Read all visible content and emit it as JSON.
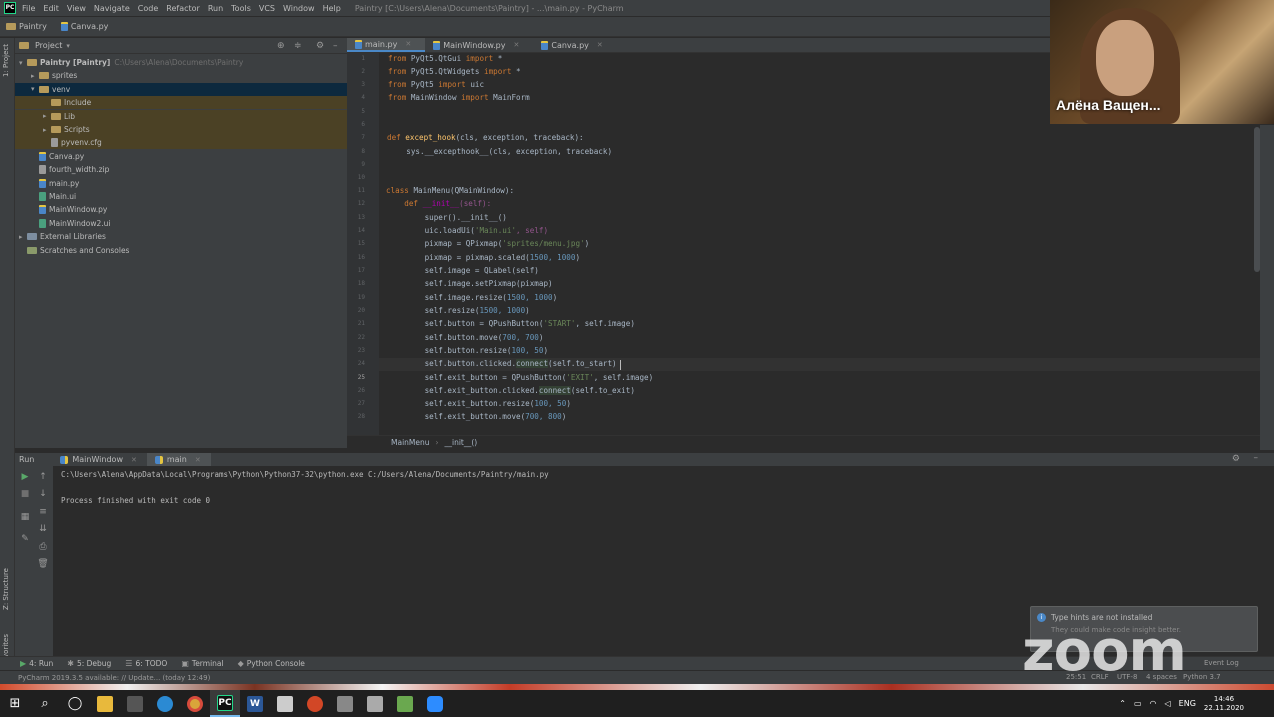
{
  "menubar": {
    "items": [
      "File",
      "Edit",
      "View",
      "Navigate",
      "Code",
      "Refactor",
      "Run",
      "Tools",
      "VCS",
      "Window",
      "Help"
    ],
    "window_title": "Paintry [C:\\Users\\Alena\\Documents\\Paintry] - ...\\main.py - PyCharm"
  },
  "navbar": {
    "project": "Paintry",
    "file": "Canva.py"
  },
  "left_stripe": {
    "project_tab": "1: Project",
    "structure_tab": "Z: Structure",
    "favorites_tab": "2: Favorites"
  },
  "project_panel": {
    "title": "Project",
    "tree": [
      {
        "label": "Paintry [Paintry]",
        "hint": "C:\\Users\\Alena\\Documents\\Paintry",
        "kind": "folder",
        "indent": 1,
        "arrow": "▾"
      },
      {
        "label": "sprites",
        "kind": "folder",
        "indent": 2,
        "arrow": "▸"
      },
      {
        "label": "venv",
        "kind": "folder",
        "indent": 2,
        "arrow": "▾",
        "state": "selected"
      },
      {
        "label": "Include",
        "kind": "folder",
        "indent": 3,
        "arrow": "",
        "state": "hl"
      },
      {
        "label": "Lib",
        "kind": "folder",
        "indent": 3,
        "arrow": "▸",
        "state": "hl"
      },
      {
        "label": "Scripts",
        "kind": "folder",
        "indent": 3,
        "arrow": "▸",
        "state": "hl"
      },
      {
        "label": "pyvenv.cfg",
        "kind": "txt",
        "indent": 3,
        "arrow": "",
        "state": "hl"
      },
      {
        "label": "Canva.py",
        "kind": "py",
        "indent": 2,
        "arrow": ""
      },
      {
        "label": "fourth_width.zip",
        "kind": "txt",
        "indent": 2,
        "arrow": ""
      },
      {
        "label": "main.py",
        "kind": "py",
        "indent": 2,
        "arrow": ""
      },
      {
        "label": "Main.ui",
        "kind": "ui",
        "indent": 2,
        "arrow": ""
      },
      {
        "label": "MainWindow.py",
        "kind": "py",
        "indent": 2,
        "arrow": ""
      },
      {
        "label": "MainWindow2.ui",
        "kind": "ui",
        "indent": 2,
        "arrow": ""
      },
      {
        "label": "External Libraries",
        "kind": "lib",
        "indent": 1,
        "arrow": "▸"
      },
      {
        "label": "Scratches and Consoles",
        "kind": "scratch",
        "indent": 1,
        "arrow": ""
      }
    ]
  },
  "editor_tabs": [
    {
      "label": "main.py",
      "active": true
    },
    {
      "label": "MainWindow.py",
      "active": false
    },
    {
      "label": "Canva.py",
      "active": false
    }
  ],
  "editor": {
    "line_numbers": [
      "1",
      "2",
      "3",
      "4",
      "5",
      "6",
      "7",
      "8",
      "9",
      "10",
      "11",
      "12",
      "13",
      "14",
      "15",
      "16",
      "17",
      "18",
      "19",
      "20",
      "21",
      "22",
      "23",
      "24",
      "25",
      "26",
      "27",
      "28"
    ],
    "code": {
      "l1": "from PyQt5.QtGui import *",
      "l2": "from PyQt5.QtWidgets import *",
      "l3": "from PyQt5 import uic",
      "l4": "from MainWindow import MainForm",
      "l8_def": "def ",
      "l8_fn": "except_hook",
      "l8_rest": "(cls, exception, traceback):",
      "l9": "    sys.__excepthook__(cls, exception, traceback)",
      "l12_kw": "class ",
      "l12_rest": "MainMenu(QMainWindow):",
      "l13_def": "    def ",
      "l13_fn": "__init__",
      "l13_self": "(self):",
      "l14": "        super().__init__()",
      "l15_a": "        uic.loadUi(",
      "l15_s": "'Main.ui'",
      "l15_b": ", self)",
      "l16_a": "        pixmap = QPixmap(",
      "l16_s": "'sprites/menu.jpg'",
      "l16_b": ")",
      "l17_a": "        pixmap = pixmap.scaled(",
      "l17_n": "1500, 1000",
      "l17_b": ")",
      "l18": "        self.image = QLabel(self)",
      "l19": "        self.image.setPixmap(pixmap)",
      "l20_a": "        self.image.resize(",
      "l20_n": "1500, 1000",
      "l20_b": ")",
      "l21_a": "        self.resize(",
      "l21_n": "1500, 1000",
      "l21_b": ")",
      "l22_a": "        self.button = QPushButton(",
      "l22_s": "'START'",
      "l22_b": ", self.image)",
      "l23_a": "        self.button.move(",
      "l23_n": "700, 700",
      "l23_b": ")",
      "l24_a": "        self.button.resize(",
      "l24_n": "100, 50",
      "l24_b": ")",
      "l25_a": "        self.button.clicked.",
      "l25_c": "connect",
      "l25_b": "(self.to_start)",
      "l26_a": "        self.exit_button = QPushButton(",
      "l26_s": "'EXIT'",
      "l26_b": ", self.image)",
      "l27_a": "        self.exit_button.clicked.",
      "l27_c": "connect",
      "l27_b": "(self.to_exit)",
      "l28_a": "        self.exit_button.resize(",
      "l28_n": "100, 50",
      "l28_b": ")",
      "l29_a": "        self.exit_button.move(",
      "l29_n": "700, 800",
      "l29_b": ")"
    },
    "current_line": "25",
    "breadcrumb": [
      "MainMenu",
      "__init__()"
    ]
  },
  "run_panel": {
    "title": "Run",
    "tabs": [
      {
        "label": "MainWindow",
        "active": false
      },
      {
        "label": "main",
        "active": true
      }
    ],
    "console": [
      "C:\\Users\\Alena\\AppData\\Local\\Programs\\Python\\Python37-32\\python.exe C:/Users/Alena/Documents/Paintry/main.py",
      "",
      "Process finished with exit code 0"
    ]
  },
  "bottom_tabs": [
    {
      "label": "4: Run",
      "icon": "run-icon"
    },
    {
      "label": "5: Debug",
      "icon": "debug-icon"
    },
    {
      "label": "6: TODO",
      "icon": "todo-icon"
    },
    {
      "label": "Terminal",
      "icon": "terminal-icon"
    },
    {
      "label": "Python Console",
      "icon": "python-console-icon"
    }
  ],
  "statusbar": {
    "message": "PyCharm 2019.3.5 available: // Update... (today 12:49)",
    "position": "25:51",
    "line_sep": "CRLF",
    "encoding": "UTF-8",
    "indent": "4 spaces",
    "interpreter": "Python 3.7",
    "event_log": "Event Log"
  },
  "notification": {
    "title": "Type hints are not installed",
    "body": "They could make code insight better."
  },
  "zoom": {
    "watermark": "zoom",
    "participant_name": "Алёна Ващен..."
  },
  "taskbar": {
    "icons": [
      "windows-start-icon",
      "search-icon",
      "task-view-icon",
      "file-explorer-icon",
      "store-icon",
      "edge-icon",
      "chrome-icon",
      "pycharm-icon",
      "word-icon",
      "notepad-icon",
      "powerpoint-icon",
      "app-icon",
      "snipping-icon",
      "paint-icon",
      "zoom-icon"
    ],
    "lang": "ENG",
    "time": "14:46",
    "date": "22.11.2020"
  }
}
